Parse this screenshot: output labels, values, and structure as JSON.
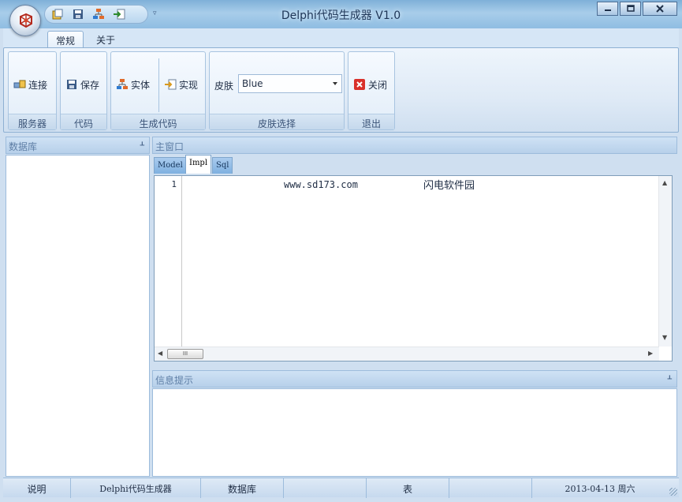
{
  "window": {
    "title": "Delphi代码生成器 V1.0",
    "minimize_icon": "minimize-icon",
    "maximize_icon": "maximize-icon",
    "close_icon": "close-icon"
  },
  "quick_access": [
    "open-icon",
    "save-icon",
    "hierarchy-icon",
    "export-icon"
  ],
  "ribbon": {
    "tabs": [
      {
        "label": "常规",
        "active": true
      },
      {
        "label": "关于",
        "active": false
      }
    ],
    "groups": [
      {
        "label": "服务器",
        "buttons": [
          {
            "label": "连接",
            "icon": "connect-icon"
          }
        ]
      },
      {
        "label": "代码",
        "buttons": [
          {
            "label": "保存",
            "icon": "save-icon"
          }
        ]
      },
      {
        "label": "生成代码",
        "buttons": [
          {
            "label": "实体",
            "icon": "entity-icon"
          },
          {
            "label": "实现",
            "icon": "implement-icon"
          }
        ]
      },
      {
        "label": "皮肤选择",
        "skin_label": "皮肤",
        "skin_value": "Blue"
      },
      {
        "label": "退出",
        "buttons": [
          {
            "label": "关闭",
            "icon": "close-icon"
          }
        ]
      }
    ]
  },
  "database_panel": {
    "title": "数据库"
  },
  "main_panel": {
    "title": "主窗口",
    "tabs": [
      {
        "label": "Model",
        "active": false
      },
      {
        "label": "Impl",
        "active": true
      },
      {
        "label": "Sql",
        "active": false
      }
    ],
    "editor": {
      "line_number": "1",
      "url_text": "www.sd173.com",
      "cn_text": "闪电软件园",
      "hscroll_thumb": "III"
    }
  },
  "info_panel": {
    "title": "信息提示"
  },
  "statusbar": {
    "cells": [
      "说明",
      "Delphi代码生成器",
      "数据库",
      "",
      "表",
      "",
      "2013-04-13 周六"
    ]
  },
  "colors": {
    "accent": "#7fb0d8",
    "panel_header": "#b7d0ea",
    "close_red": "#d9312b"
  }
}
